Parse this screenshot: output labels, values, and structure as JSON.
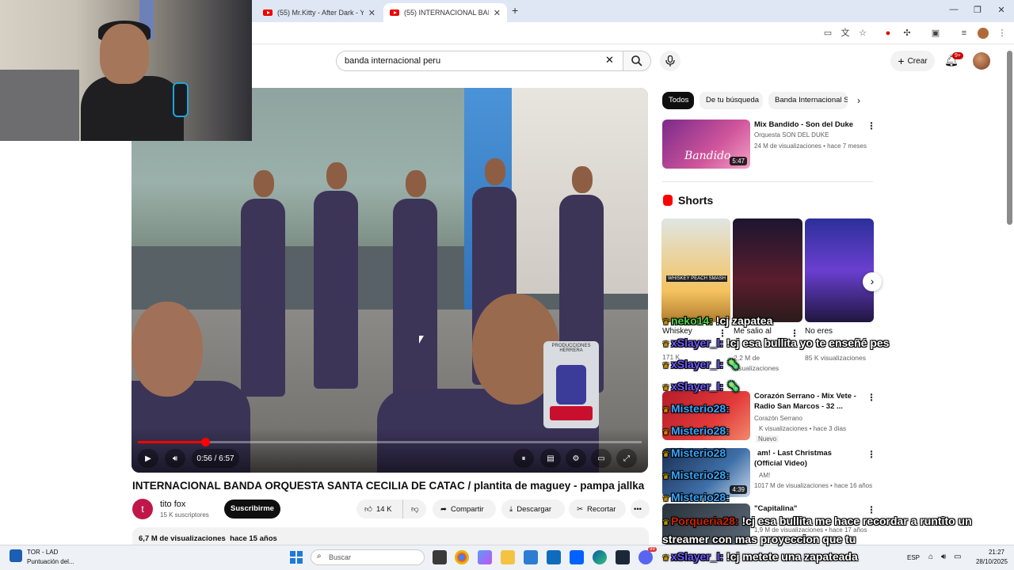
{
  "browser": {
    "tabs": [
      {
        "title": "(55) Mr.Kitty - After Dark - YouT",
        "active": false
      },
      {
        "title": "(55) INTERNACIONAL BANDA O",
        "active": true
      }
    ],
    "new_tab": "+",
    "window_controls": [
      "—",
      "❐",
      "✕"
    ]
  },
  "youtube": {
    "search_query": "banda internacional peru",
    "create_label": "Crear",
    "notifications_badge": "9+"
  },
  "player": {
    "current_time": "0:56",
    "duration": "6:57",
    "time_display": "0:56 / 6:57",
    "progress": 0.134,
    "watermark": "PRODUCCIONES HERRERA"
  },
  "video": {
    "title": "INTERNACIONAL BANDA ORQUESTA SANTA CECILIA DE CATAC / plantita de maguey - pampa jallka",
    "channel_initial": "t",
    "channel_name": "tito fox",
    "channel_subs": "15 K suscriptores",
    "subscribe_label": "Suscribirme",
    "likes": "14 K",
    "share_label": "Compartir",
    "download_label": "Descargar",
    "clip_label": "Recortar",
    "more_label": "•••",
    "views": "6,7 M de visualizaciones",
    "age": "hace 15 años"
  },
  "sidebar": {
    "chips": [
      "Todos",
      "De tu búsqueda",
      "Banda Internacional S"
    ],
    "top_video": {
      "title": "Mix Bandido - Son del Duke",
      "channel": "Orquesta SON DEL DUKE",
      "meta": "24 M de visualizaciones • hace 7 meses",
      "duration": "5:47",
      "thumb_text": "Bandido"
    },
    "shorts_heading": "Shorts",
    "shorts": [
      {
        "title": "Whiskey",
        "views": "171 K",
        "thumb_text": "WHISKEY PEACH SMASH"
      },
      {
        "title": "Me salio al",
        "views": "2,2 M de visualizaciones"
      },
      {
        "title": "No eres",
        "views": "85 K visualizaciones"
      }
    ],
    "videos": [
      {
        "title": "Corazón Serrano - Mix Vete -",
        "title2": "Radio San Marcos - 32 ...",
        "channel": "Corazón Serrano",
        "meta": "K visualizaciones • hace 3 días",
        "badge": "Nuevo"
      },
      {
        "title": "am! - Last Christmas",
        "title2": "(Official Video)",
        "channel": "AM!",
        "meta": "1017 M de visualizaciones • hace 16 años",
        "duration": "4:39"
      },
      {
        "title": "\"Capitalina\"",
        "meta": "1,9 M de visualizaciones • hace 17 años"
      }
    ]
  },
  "chat": [
    {
      "user": "neko14:",
      "message": "!cj zapatea"
    },
    {
      "user": "xSlayer_l:",
      "message": "!cj esa bullita yo te enseñé pes"
    },
    {
      "user": "xSlayer_l:",
      "message": "🦠"
    },
    {
      "user": "xSlayer_l:",
      "message": "🦠"
    },
    {
      "user": "Misterio28:",
      "message": ""
    },
    {
      "user": "Misterio28:",
      "message": ""
    },
    {
      "user": "Misterio28",
      "message": ""
    },
    {
      "user": "Misterio28:",
      "message": ""
    },
    {
      "user": "Misterio28:",
      "message": ""
    },
    {
      "user": "Porqueria28:",
      "message": "!cj esa bullita me hace recordar a runtito un streamer con mas proyeccion que tu"
    },
    {
      "user": "xSlayer_l:",
      "message": "!cj metete una zapateada"
    }
  ],
  "taskbar": {
    "weather_temp": "TOR - LAD",
    "weather_desc": "Puntuación del...",
    "search_placeholder": "Buscar",
    "language": "ESP",
    "time": "21:27",
    "date": "28/10/2025",
    "discord_badge": "99"
  },
  "colors": {
    "accent_red": "#ff0000",
    "chat_green": "#4fd24f",
    "chat_purple": "#6d5cff",
    "chat_blue": "#36a7ff",
    "taskbar_bg": "#eef1f6"
  }
}
